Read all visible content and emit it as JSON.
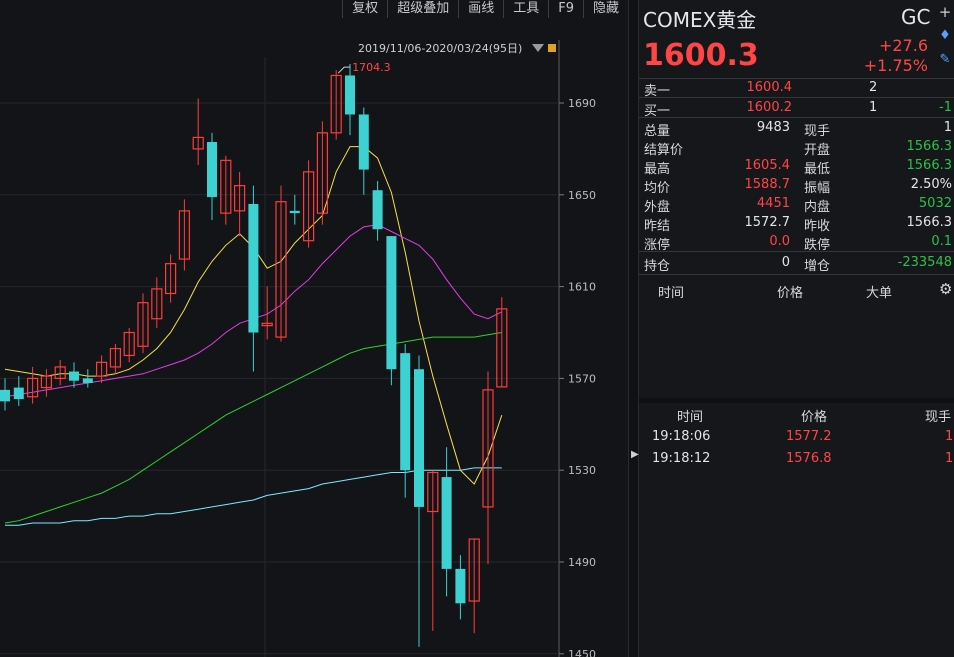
{
  "toolbar": {
    "items": [
      "复权",
      "超级叠加",
      "画线",
      "工具",
      "F9",
      "隐藏"
    ]
  },
  "chart": {
    "range_label": "2019/11/06-2020/03/24(95日)",
    "max_label": "1704.3",
    "y_ticks": [
      "1690",
      "1650",
      "1610",
      "1570",
      "1530",
      "1490",
      "1450"
    ],
    "colors": {
      "up": "#ff3b3b",
      "down": "#3dd1d1",
      "ma5": "#e8e8e8",
      "ma10": "#f5e04a",
      "ma20": "#ff9a2e",
      "ma30": "#e040e0",
      "ma60": "#2fd12f",
      "ma120": "#7fe8ff"
    }
  },
  "chart_data": {
    "type": "candlestick",
    "ylim": [
      1450,
      1712
    ],
    "candles": [
      {
        "o": 1565,
        "h": 1570,
        "l": 1556,
        "c": 1560
      },
      {
        "o": 1566,
        "h": 1571,
        "l": 1558,
        "c": 1561
      },
      {
        "o": 1562,
        "h": 1575,
        "l": 1559,
        "c": 1570
      },
      {
        "o": 1566,
        "h": 1574,
        "l": 1562,
        "c": 1571
      },
      {
        "o": 1570,
        "h": 1578,
        "l": 1567,
        "c": 1575
      },
      {
        "o": 1573,
        "h": 1577,
        "l": 1566,
        "c": 1569
      },
      {
        "o": 1570,
        "h": 1574,
        "l": 1566,
        "c": 1568
      },
      {
        "o": 1571,
        "h": 1580,
        "l": 1568,
        "c": 1577
      },
      {
        "o": 1575,
        "h": 1585,
        "l": 1572,
        "c": 1583
      },
      {
        "o": 1580,
        "h": 1592,
        "l": 1577,
        "c": 1590
      },
      {
        "o": 1584,
        "h": 1607,
        "l": 1581,
        "c": 1603
      },
      {
        "o": 1596,
        "h": 1614,
        "l": 1592,
        "c": 1609
      },
      {
        "o": 1607,
        "h": 1624,
        "l": 1603,
        "c": 1620
      },
      {
        "o": 1622,
        "h": 1648,
        "l": 1617,
        "c": 1643
      },
      {
        "o": 1670,
        "h": 1692,
        "l": 1663,
        "c": 1675
      },
      {
        "o": 1673,
        "h": 1677,
        "l": 1639,
        "c": 1649
      },
      {
        "o": 1642,
        "h": 1667,
        "l": 1637,
        "c": 1665
      },
      {
        "o": 1643,
        "h": 1660,
        "l": 1632,
        "c": 1654
      },
      {
        "o": 1646,
        "h": 1654,
        "l": 1573,
        "c": 1590
      },
      {
        "o": 1593,
        "h": 1610,
        "l": 1587,
        "c": 1594
      },
      {
        "o": 1588,
        "h": 1654,
        "l": 1586,
        "c": 1647
      },
      {
        "o": 1643,
        "h": 1650,
        "l": 1637,
        "c": 1642
      },
      {
        "o": 1630,
        "h": 1665,
        "l": 1627,
        "c": 1660
      },
      {
        "o": 1642,
        "h": 1682,
        "l": 1637,
        "c": 1677
      },
      {
        "o": 1677,
        "h": 1704.3,
        "l": 1674,
        "c": 1702
      },
      {
        "o": 1702,
        "h": 1707,
        "l": 1676,
        "c": 1685
      },
      {
        "o": 1685,
        "h": 1688,
        "l": 1650,
        "c": 1661
      },
      {
        "o": 1652,
        "h": 1656,
        "l": 1630,
        "c": 1635
      },
      {
        "o": 1632,
        "h": 1632,
        "l": 1567,
        "c": 1574
      },
      {
        "o": 1581,
        "h": 1585,
        "l": 1518,
        "c": 1530
      },
      {
        "o": 1574,
        "h": 1580,
        "l": 1453,
        "c": 1514
      },
      {
        "o": 1512,
        "h": 1530,
        "l": 1460,
        "c": 1529
      },
      {
        "o": 1527,
        "h": 1540,
        "l": 1475,
        "c": 1487
      },
      {
        "o": 1487,
        "h": 1493,
        "l": 1465,
        "c": 1472
      },
      {
        "o": 1473,
        "h": 1500,
        "l": 1459,
        "c": 1500
      },
      {
        "o": 1514,
        "h": 1573,
        "l": 1489,
        "c": 1565
      },
      {
        "o": 1566.3,
        "h": 1605.4,
        "l": 1566.3,
        "c": 1600.3
      }
    ],
    "ma": {
      "ma10": [
        1574,
        1573,
        1572,
        1571,
        1572,
        1572,
        1571,
        1571,
        1572,
        1574,
        1578,
        1583,
        1590,
        1600,
        1612,
        1621,
        1628,
        1633,
        1627,
        1618,
        1621,
        1629,
        1635,
        1641,
        1660,
        1671,
        1671,
        1666,
        1651,
        1625,
        1595,
        1571,
        1550,
        1530,
        1524,
        1536,
        1554
      ],
      "ma30": [
        1562,
        1563,
        1564,
        1565,
        1566,
        1567,
        1568,
        1569,
        1570,
        1571,
        1572,
        1574,
        1576,
        1578,
        1581,
        1585,
        1590,
        1594,
        1596,
        1598,
        1602,
        1608,
        1613,
        1620,
        1626,
        1632,
        1636,
        1637,
        1634,
        1631,
        1628,
        1622,
        1613,
        1605,
        1598,
        1596,
        1599
      ],
      "ma60": [
        1507,
        1508,
        1510,
        1512,
        1514,
        1516,
        1518,
        1520,
        1523,
        1526,
        1530,
        1534,
        1538,
        1542,
        1546,
        1550,
        1554,
        1557,
        1560,
        1563,
        1566,
        1569,
        1572,
        1575,
        1578,
        1581,
        1583,
        1584,
        1585,
        1586,
        1587,
        1588,
        1588,
        1588,
        1588,
        1589,
        1590
      ],
      "ma120": [
        1506,
        1506,
        1507,
        1507,
        1507,
        1508,
        1508,
        1509,
        1509,
        1510,
        1510,
        1511,
        1511,
        1512,
        1513,
        1514,
        1515,
        1516,
        1517,
        1519,
        1520,
        1521,
        1522,
        1524,
        1525,
        1526,
        1527,
        1528,
        1529,
        1529,
        1530,
        1530,
        1530,
        1530,
        1531,
        1531,
        1531
      ]
    }
  },
  "quote": {
    "name": "COMEX黄金",
    "code": "GC",
    "price": "1600.3",
    "change": "+27.6",
    "change_pct": "+1.75%",
    "sell_label": "卖一",
    "sell_price": "1600.4",
    "sell_qty": "2",
    "buy_label": "买一",
    "buy_price": "1600.2",
    "buy_qty": "1",
    "buy_chg": "-1",
    "stats": [
      {
        "l1": "总量",
        "v1": "9483",
        "c1": "white",
        "l2": "现手",
        "v2": "1",
        "c2": "white"
      },
      {
        "l1": "结算价",
        "v1": "",
        "c1": "white",
        "l2": "开盘",
        "v2": "1566.3",
        "c2": "green"
      },
      {
        "l1": "最高",
        "v1": "1605.4",
        "c1": "red",
        "l2": "最低",
        "v2": "1566.3",
        "c2": "green"
      },
      {
        "l1": "均价",
        "v1": "1588.7",
        "c1": "red",
        "l2": "振幅",
        "v2": "2.50%",
        "c2": "white"
      },
      {
        "l1": "外盘",
        "v1": "4451",
        "c1": "red",
        "l2": "内盘",
        "v2": "5032",
        "c2": "green"
      },
      {
        "l1": "昨结",
        "v1": "1572.7",
        "c1": "white",
        "l2": "昨收",
        "v2": "1566.3",
        "c2": "white"
      },
      {
        "l1": "涨停",
        "v1": "0.0",
        "c1": "red",
        "l2": "跌停",
        "v2": "0.1",
        "c2": "green"
      }
    ],
    "hold_label": "持仓",
    "hold_value": "0",
    "incr_label": "增仓",
    "incr_value": "-233548"
  },
  "ticks_header": {
    "time": "时间",
    "price": "价格",
    "big": "大单"
  },
  "trades": {
    "header": {
      "time": "时间",
      "price": "价格",
      "qty": "现手"
    },
    "rows": [
      {
        "time": "19:18:06",
        "price": "1577.2",
        "qty": "1"
      },
      {
        "time": "19:18:12",
        "price": "1576.8",
        "qty": "1"
      }
    ]
  }
}
